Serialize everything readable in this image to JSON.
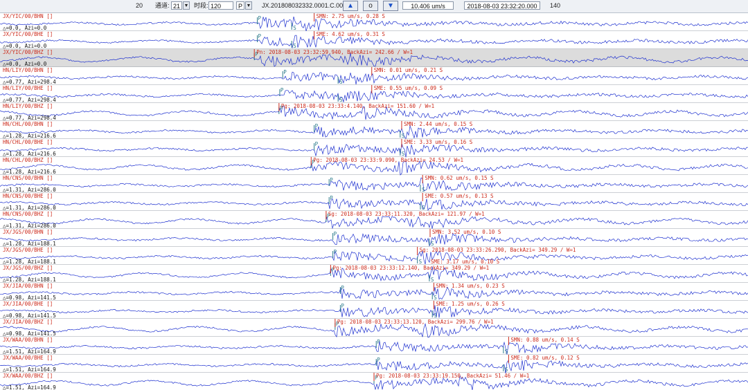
{
  "toolbar": {
    "count": "20",
    "channel_label": "通道:",
    "channel_value": "21",
    "time_label": "时段:",
    "time_value": "120",
    "phase_value": "P",
    "event_id": "JX.20180803233​2.0001.C.001",
    "up_icon": "triangle-up-icon",
    "center_label": "o",
    "down_icon": "triangle-down-icon",
    "amplitude": "10.406 um/s",
    "datetime": "2018-08-03 23:32:20.000",
    "right_value": "140"
  },
  "colors": {
    "trace": "#1c2fcf",
    "label": "#cc2a1a",
    "marker": "#2a7a8a",
    "highlight": "#dcdcdc"
  },
  "channels": [
    {
      "name": "JX/YIC/00/BHN []",
      "info": "△=0.0, Azi=0.0",
      "onset": 0.347,
      "p": 0.344,
      "s": 0.39,
      "pick": "SMN: 2.75 um/s, 0.28  S",
      "pick_x": 0.42
    },
    {
      "name": "JX/YIC/00/BHE []",
      "info": "△=0.0, Azi=0.0",
      "onset": 0.347,
      "p": 0.344,
      "s": 0.39,
      "pick": "SME: 4.62 um/s, 0.31  S",
      "pick_x": 0.42
    },
    {
      "name": "JX/YIC/00/BHZ []",
      "info": "△=0.0, Azi=0.0",
      "onset": 0.347,
      "p": 0.34,
      "s": 0.0,
      "pick": "Pn: 2018-08-03 23:32:59.940, BackAzi= 242.66 / W=1",
      "pick_x": 0.34,
      "highlight": true
    },
    {
      "name": "HN/LIY/00/BHN []",
      "info": "△=0.77, Azi=298.4",
      "onset": 0.38,
      "p": 0.378,
      "s": 0.452,
      "pick": "SMN: 0.01 um/s, 0.21  S",
      "pick_x": 0.497
    },
    {
      "name": "HN/LIY/00/BHE []",
      "info": "△=0.77, Azi=298.4",
      "onset": 0.38,
      "p": 0.374,
      "s": 0.452,
      "pick": "SME: 0.55 um/s, 0.09  S",
      "pick_x": 0.497
    },
    {
      "name": "HN/LIY/00/BHZ []",
      "info": "△=0.77, Azi=298.4",
      "onset": 0.373,
      "p": 0.373,
      "s": 0.0,
      "pick": "Pg: 2018-08-03 23:33:4.140, BackAzi= 151.60 / W=1",
      "pick_x": 0.373
    },
    {
      "name": "HN/CHL/00/BHN []",
      "info": "△=1.28, Azi=216.6",
      "onset": 0.422,
      "p": 0.42,
      "s": 0.535,
      "pick": "SMN: 2.44 um/s, 0.15  S",
      "pick_x": 0.537
    },
    {
      "name": "HN/CHL/00/BHE []",
      "info": "△=1.28, Azi=216.6",
      "onset": 0.422,
      "p": 0.42,
      "s": 0.535,
      "pick": "SME: 3.33 um/s, 0.16  S",
      "pick_x": 0.537
    },
    {
      "name": "HN/CHL/00/BHZ []",
      "info": "△=1.28, Azi=216.6",
      "onset": 0.416,
      "p": 0.416,
      "s": 0.0,
      "pick": "Pg: 2018-08-03 23:33:9.090, BackAzi= 24.53 / W=1",
      "pick_x": 0.416
    },
    {
      "name": "HN/CNS/00/BHN []",
      "info": "△=1.31, Azi=286.0",
      "onset": 0.44,
      "p": 0.44,
      "s": 0.562,
      "pick": "SMN: 0.62 um/s, 0.15  S",
      "pick_x": 0.565
    },
    {
      "name": "HN/CNS/00/BHE []",
      "info": "△=1.31, Azi=286.0",
      "onset": 0.44,
      "p": 0.44,
      "s": 0.562,
      "pick": "SME: 0.57 um/s, 0.13  S",
      "pick_x": 0.565
    },
    {
      "name": "HN/CNS/00/BHZ []",
      "info": "△=1.31, Azi=286.0",
      "onset": 0.436,
      "p": 0.436,
      "s": 0.0,
      "pick": "Sg: 2018-08-03 23:33:11.320, BackAzi= 121.97 / W=1",
      "pick_x": 0.436
    },
    {
      "name": "JX/JGS/00/BHN []",
      "info": "△=1.28, Azi=188.1",
      "onset": 0.445,
      "p": 0.445,
      "s": 0.574,
      "pick": "SMN: 3.52 um/s, 0.10  S",
      "pick_x": 0.575
    },
    {
      "name": "JX/JGS/00/BHE []",
      "info": "△=1.28, Azi=188.1",
      "onset": 0.445,
      "p": 0.445,
      "s": 0.558,
      "pick": "Sg: 2018-08-03 23:33:26.290, BackAzi= 349.29 / W=1",
      "pick_x": 0.558
    },
    {
      "name": "JX/JGS/00/BHZ []",
      "info": "△=1.28, Azi=188.1",
      "onset": 0.442,
      "p": 0.442,
      "s": 0.574,
      "pick": "Pg: 2018-08-03 23:33:12.140, BackAzi= 349.29 / W=1",
      "pick_x": 0.442,
      "pick2": "SME: 3.17 um/s, 0.10  S",
      "pick2_x": 0.573
    },
    {
      "name": "JX/JIA/00/BHN []",
      "info": "△=0.98, Azi=141.5",
      "onset": 0.455,
      "p": 0.455,
      "s": 0.578,
      "pick": "SMN: 1.34 um/s, 0.23  S",
      "pick_x": 0.58
    },
    {
      "name": "JX/JIA/00/BHE []",
      "info": "△=0.98, Azi=141.5",
      "onset": 0.455,
      "p": 0.455,
      "s": 0.578,
      "pick": "SME: 1.25 um/s, 0.26  S",
      "pick_x": 0.58
    },
    {
      "name": "JX/JIA/00/BHZ []",
      "info": "△=0.98, Azi=141.5",
      "onset": 0.448,
      "p": 0.448,
      "s": 0.0,
      "pick": "Pg: 2018-08-03 23:33:13.120, BackAzi= 299.76 / W=1",
      "pick_x": 0.448
    },
    {
      "name": "JX/WAA/00/BHN []",
      "info": "△=1.51, Azi=164.9",
      "onset": 0.503,
      "p": 0.503,
      "s": 0.673,
      "pick": "SMN: 0.88 um/s, 0.14  S",
      "pick_x": 0.68
    },
    {
      "name": "JX/WAA/00/BHE []",
      "info": "△=1.51, Azi=164.9",
      "onset": 0.503,
      "p": 0.503,
      "s": 0.673,
      "pick": "SME: 0.82 um/s, 0.12  S",
      "pick_x": 0.68
    },
    {
      "name": "JX/WAA/00/BHZ []",
      "info": "△=1.51, Azi=164.9",
      "onset": 0.5,
      "p": 0.5,
      "s": 0.0,
      "pick": "Pg: 2018-08-03 23:33:19.150, BackAzi= 51.46 / W=1",
      "pick_x": 0.5
    }
  ]
}
